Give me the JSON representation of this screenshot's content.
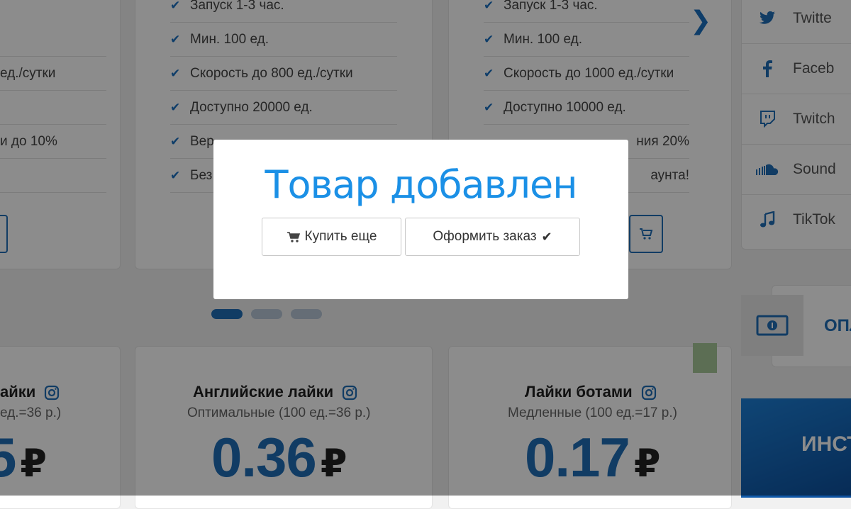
{
  "slider": {
    "card1": {
      "features": [
        "ед./сутки",
        "и до 10%"
      ]
    },
    "card2": {
      "features": [
        "Запуск 1-3 час.",
        "Мин. 100 ед.",
        "Скорость до 800 ед./сутки",
        "Доступно 20000 ед.",
        "Вер",
        "Без"
      ]
    },
    "card3": {
      "features": [
        "Запуск 1-3 час.",
        "Мин. 100 ед.",
        "Скорость до 1000 ед./сутки",
        "Доступно 10000 ед.",
        "ния 20%",
        "аунта!"
      ]
    },
    "next_arrow": "❯"
  },
  "social": {
    "items": [
      {
        "label": "Twitte",
        "icon": "twitter-icon"
      },
      {
        "label": "Faceb",
        "icon": "facebook-icon"
      },
      {
        "label": "Twitch",
        "icon": "twitch-icon"
      },
      {
        "label": "Sound",
        "icon": "soundcloud-icon"
      },
      {
        "label": "TikTok",
        "icon": "music-icon"
      }
    ]
  },
  "payment": {
    "label": "ОПЛ"
  },
  "banner": {
    "text": "ИНСТ"
  },
  "products": [
    {
      "title": "айки",
      "subtitle": "ед.=36 р.)",
      "price": "5",
      "currency": "₽"
    },
    {
      "title": "Английские лайки",
      "subtitle": "Оптимальные (100 ед.=36 р.)",
      "price": "0.36",
      "currency": "₽"
    },
    {
      "title": "Лайки ботами",
      "subtitle": "Медленные (100 ед.=17 р.)",
      "price": "0.17",
      "currency": "₽"
    }
  ],
  "modal": {
    "title": "Товар добавлен",
    "buy_more": "Купить еще",
    "checkout": "Оформить заказ"
  },
  "colors": {
    "accent": "#1f6db7",
    "modal_title": "#1b90e6"
  }
}
